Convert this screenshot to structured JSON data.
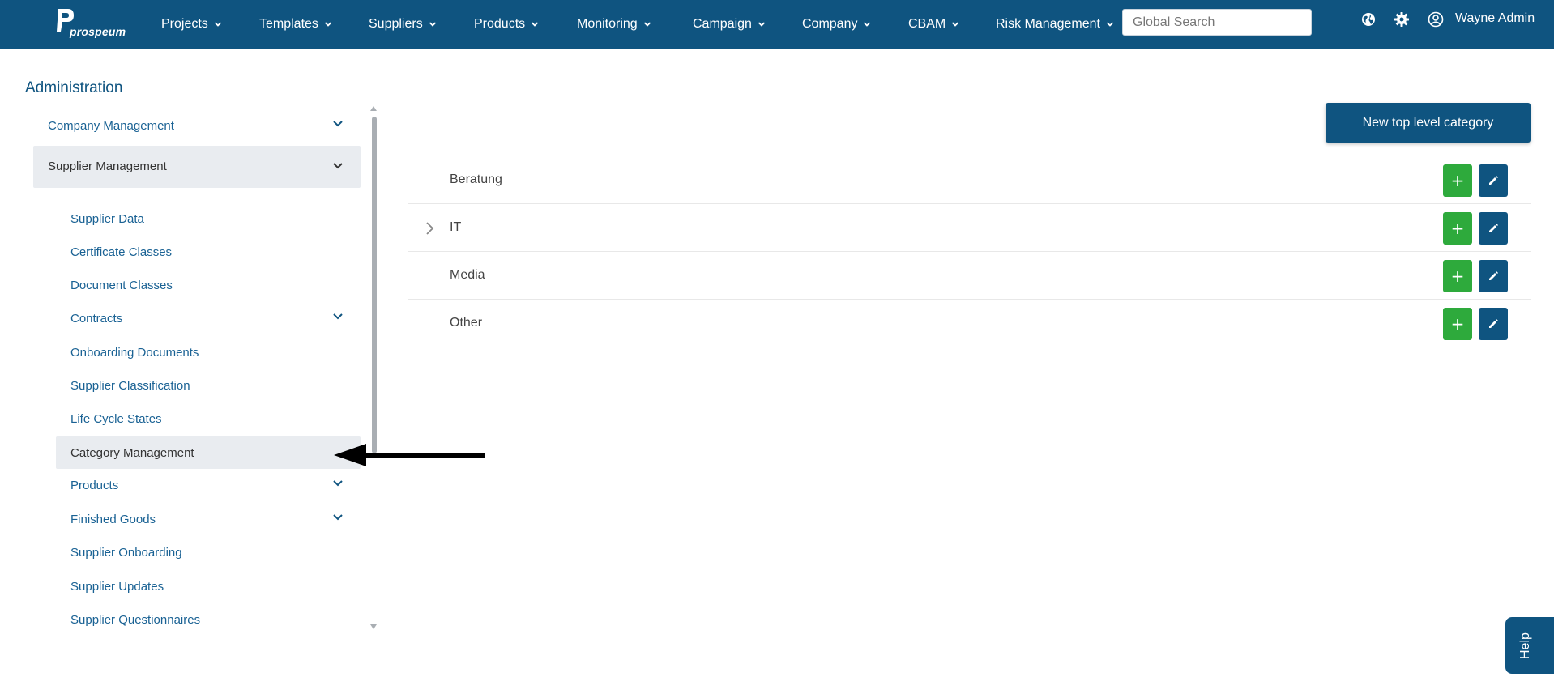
{
  "brand": {
    "logo_text": "prospeum",
    "accent": "#0f5480",
    "add_color": "#2eaa3c"
  },
  "nav": {
    "items": [
      "Projects",
      "Templates",
      "Suppliers",
      "Products",
      "Monitoring",
      "Campaign",
      "Company",
      "CBAM",
      "Risk Management"
    ],
    "search_placeholder": "Global Search",
    "icons": [
      "globe-icon",
      "gear-icon",
      "user-circle-icon"
    ],
    "user": "Wayne Admin"
  },
  "sidebar": {
    "title": "Administration",
    "groups": [
      {
        "label": "Company Management",
        "expanded": false
      },
      {
        "label": "Supplier Management",
        "expanded": true
      }
    ],
    "items": [
      {
        "label": "Supplier Data",
        "has_children": false
      },
      {
        "label": "Certificate Classes",
        "has_children": false
      },
      {
        "label": "Document Classes",
        "has_children": false
      },
      {
        "label": "Contracts",
        "has_children": true
      },
      {
        "label": "Onboarding Documents",
        "has_children": false
      },
      {
        "label": "Supplier Classification",
        "has_children": false
      },
      {
        "label": "Life Cycle States",
        "has_children": false
      },
      {
        "label": "Category Management",
        "has_children": false,
        "active": true
      },
      {
        "label": "Products",
        "has_children": true
      },
      {
        "label": "Finished Goods",
        "has_children": true
      },
      {
        "label": "Supplier Onboarding",
        "has_children": false
      },
      {
        "label": "Supplier Updates",
        "has_children": false
      },
      {
        "label": "Supplier Questionnaires",
        "has_children": false
      }
    ]
  },
  "main": {
    "new_category_label": "New top level category",
    "categories": [
      {
        "name": "Beratung",
        "expandable": false
      },
      {
        "name": "IT",
        "expandable": true
      },
      {
        "name": "Media",
        "expandable": false
      },
      {
        "name": "Other",
        "expandable": false
      }
    ],
    "add_symbol": "+"
  },
  "help": {
    "label": "Help"
  }
}
